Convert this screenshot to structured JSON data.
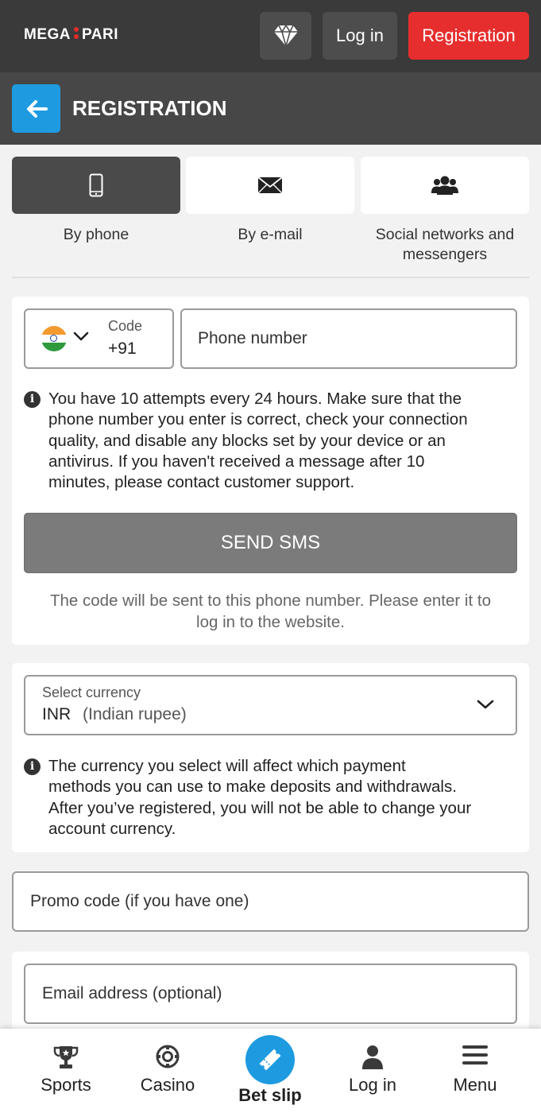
{
  "header": {
    "logo_left": "MEGA",
    "logo_right": "PARI",
    "login_label": "Log in",
    "registration_label": "Registration"
  },
  "page": {
    "title": "REGISTRATION"
  },
  "methods": [
    {
      "label": "By phone",
      "active": true
    },
    {
      "label": "By e-mail",
      "active": false
    },
    {
      "label_line1": "Social networks and",
      "label_line2": "messengers",
      "active": false
    }
  ],
  "phone_form": {
    "code_label": "Code",
    "code_value": "+91",
    "phone_placeholder": "Phone number",
    "info_lines": [
      "You have 10 attempts every 24 hours. Make sure that the",
      "phone number you enter is correct, check your connection",
      "quality, and disable any blocks set by your device or an",
      "antivirus. If you haven't received a message after 10",
      "minutes, please contact customer support."
    ],
    "send_sms_label": "SEND SMS",
    "note_line1": "The code will be sent to this phone number. Please enter it to",
    "note_line2": "log in to the website."
  },
  "currency_form": {
    "label": "Select currency",
    "code": "INR",
    "name": "(Indian rupee)",
    "info_lines": [
      "The currency you select will affect which payment",
      "methods you can use to make deposits and withdrawals.",
      "After you’ve registered, you will not be able to change your",
      "account currency."
    ]
  },
  "promo": {
    "placeholder": "Promo code (if you have one)"
  },
  "email": {
    "placeholder": "Email address (optional)"
  },
  "bottom_nav": [
    {
      "label": "Sports",
      "icon": "trophy-icon"
    },
    {
      "label": "Casino",
      "icon": "casino-chip-icon"
    },
    {
      "label": "Bet slip",
      "icon": "ticket-icon"
    },
    {
      "label": "Log in",
      "icon": "user-icon"
    },
    {
      "label": "Menu",
      "icon": "menu-icon"
    }
  ],
  "colors": {
    "accent_red": "#e62e2e",
    "accent_blue": "#1e9be0",
    "header_bg": "#3a3a3a"
  }
}
